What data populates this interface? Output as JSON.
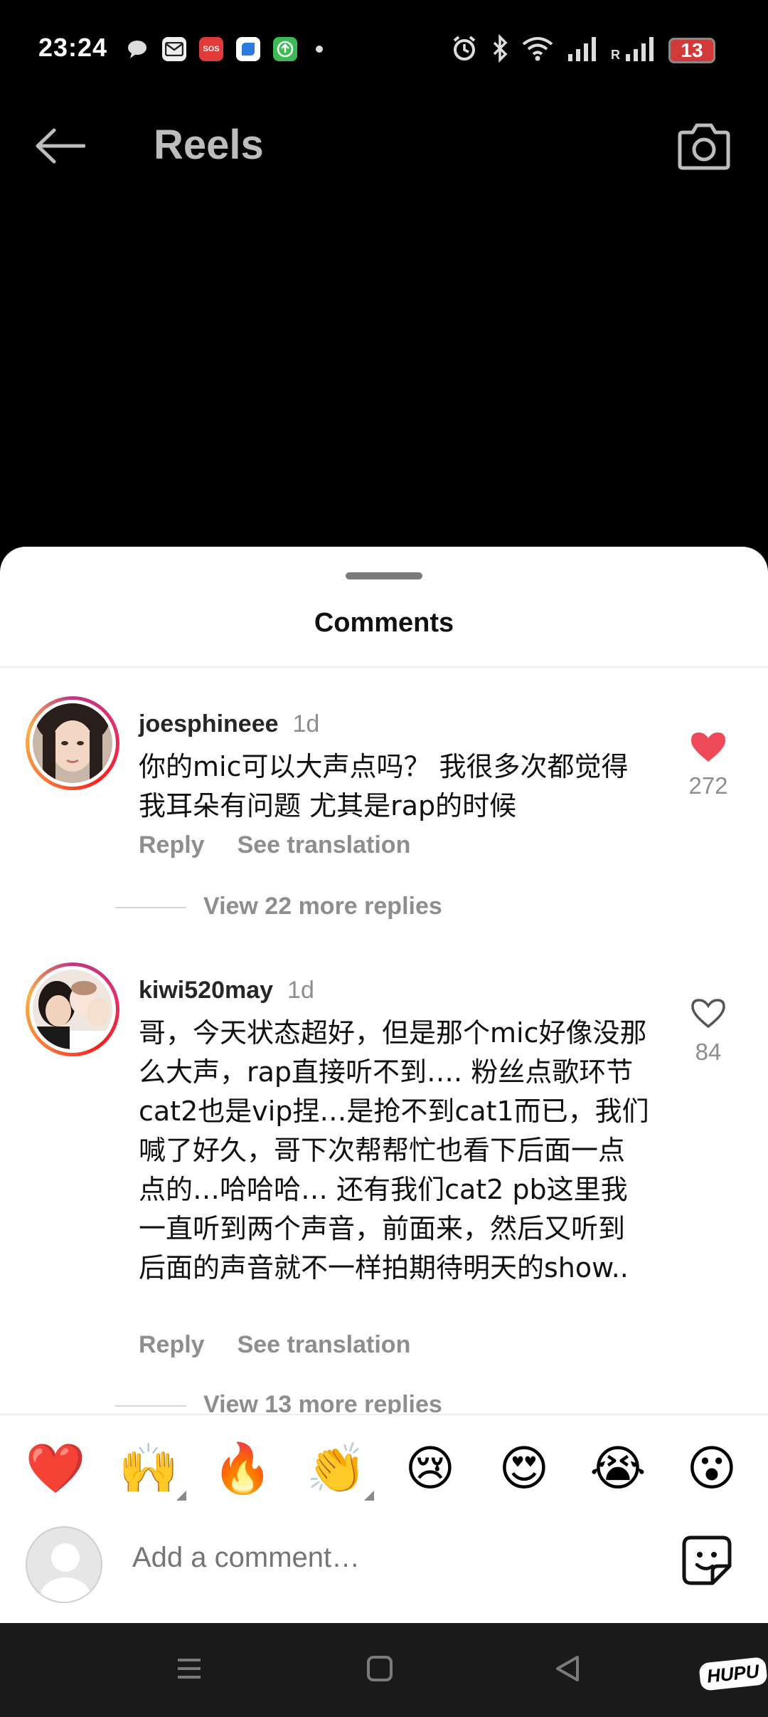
{
  "status_bar": {
    "time": "23:24",
    "sos_label": "SOS",
    "signal_r": "R",
    "battery": "13"
  },
  "header": {
    "title": "Reels"
  },
  "sheet": {
    "title": "Comments"
  },
  "comments": [
    {
      "username": "joesphineee",
      "ago": "1d",
      "text": "你的mic可以大声点吗？ 我很多次都觉得我耳朵有问题 尤其是rap的时候",
      "reply_label": "Reply",
      "translate_label": "See translation",
      "likes": "272",
      "liked": true,
      "view_replies": "View 22 more replies"
    },
    {
      "username": "kiwi520may",
      "ago": "1d",
      "text": "哥，今天状态超好，但是那个mic好像没那么大声，rap直接听不到…. 粉丝点歌环节cat2也是vip捏…是抢不到cat1而已，我们喊了好久，哥下次帮帮忙也看下后面一点点的…哈哈哈… 还有我们cat2 pb这里我一直听到两个声音，前面来，然后又听到后面的声音就不一样拍期待明天的show..",
      "reply_label": "Reply",
      "translate_label": "See translation",
      "likes": "84",
      "liked": false,
      "view_replies": "View 13 more replies"
    }
  ],
  "reactions": [
    "❤️",
    "🙌",
    "🔥",
    "👏",
    "😢",
    "😍",
    "😭",
    "😮"
  ],
  "composer": {
    "placeholder": "Add a comment…"
  },
  "watermark": "HUPU",
  "colors": {
    "like_red": "#ed4956",
    "text_gray": "#8e8e8e",
    "header_gray": "#bdbdbd"
  },
  "icons": {
    "back": "arrow-left-icon",
    "camera": "camera-icon",
    "heart_filled": "heart-filled-icon",
    "heart_outline": "heart-outline-icon",
    "sticker": "sticker-icon"
  }
}
